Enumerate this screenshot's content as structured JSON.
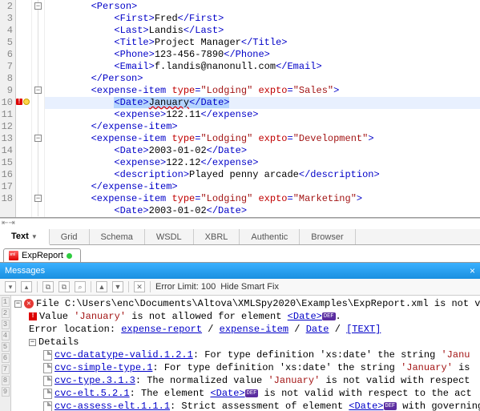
{
  "editor": {
    "lines": [
      {
        "num": 2,
        "indent": 2,
        "fold": "-",
        "parts": [
          {
            "t": "tag",
            "v": "<Person>"
          }
        ]
      },
      {
        "num": 3,
        "indent": 3,
        "parts": [
          {
            "t": "tag",
            "v": "<First>"
          },
          {
            "t": "txt",
            "v": "Fred"
          },
          {
            "t": "tag",
            "v": "</First>"
          }
        ]
      },
      {
        "num": 4,
        "indent": 3,
        "parts": [
          {
            "t": "tag",
            "v": "<Last>"
          },
          {
            "t": "txt",
            "v": "Landis"
          },
          {
            "t": "tag",
            "v": "</Last>"
          }
        ]
      },
      {
        "num": 5,
        "indent": 3,
        "parts": [
          {
            "t": "tag",
            "v": "<Title>"
          },
          {
            "t": "txt",
            "v": "Project Manager"
          },
          {
            "t": "tag",
            "v": "</Title>"
          }
        ]
      },
      {
        "num": 6,
        "indent": 3,
        "parts": [
          {
            "t": "tag",
            "v": "<Phone>"
          },
          {
            "t": "txt",
            "v": "123-456-7890"
          },
          {
            "t": "tag",
            "v": "</Phone>"
          }
        ]
      },
      {
        "num": 7,
        "indent": 3,
        "parts": [
          {
            "t": "tag",
            "v": "<Email>"
          },
          {
            "t": "txt",
            "v": "f.landis@nanonull.com"
          },
          {
            "t": "tag",
            "v": "</Email>"
          }
        ]
      },
      {
        "num": 8,
        "indent": 2,
        "parts": [
          {
            "t": "tag",
            "v": "</Person>"
          }
        ]
      },
      {
        "num": 9,
        "indent": 2,
        "fold": "-",
        "parts": [
          {
            "t": "tag",
            "v": "<expense-item "
          },
          {
            "t": "attr",
            "v": "type"
          },
          {
            "t": "tag",
            "v": "="
          },
          {
            "t": "val",
            "v": "\"Lodging\""
          },
          {
            "t": "tag",
            "v": " "
          },
          {
            "t": "attr",
            "v": "expto"
          },
          {
            "t": "tag",
            "v": "="
          },
          {
            "t": "val",
            "v": "\"Sales\""
          },
          {
            "t": "tag",
            "v": ">"
          }
        ]
      },
      {
        "num": 10,
        "indent": 3,
        "error": true,
        "highlight": true,
        "selection": true,
        "parts": [
          {
            "t": "tag",
            "v": "<Date>"
          },
          {
            "t": "txt",
            "v": "January",
            "squig": true
          },
          {
            "t": "tag",
            "v": "</Date>"
          }
        ]
      },
      {
        "num": 11,
        "indent": 3,
        "parts": [
          {
            "t": "tag",
            "v": "<expense>"
          },
          {
            "t": "txt",
            "v": "122.11"
          },
          {
            "t": "tag",
            "v": "</expense>"
          }
        ]
      },
      {
        "num": 12,
        "indent": 2,
        "parts": [
          {
            "t": "tag",
            "v": "</expense-item>"
          }
        ]
      },
      {
        "num": 13,
        "indent": 2,
        "fold": "-",
        "parts": [
          {
            "t": "tag",
            "v": "<expense-item "
          },
          {
            "t": "attr",
            "v": "type"
          },
          {
            "t": "tag",
            "v": "="
          },
          {
            "t": "val",
            "v": "\"Lodging\""
          },
          {
            "t": "tag",
            "v": " "
          },
          {
            "t": "attr",
            "v": "expto"
          },
          {
            "t": "tag",
            "v": "="
          },
          {
            "t": "val",
            "v": "\"Development\""
          },
          {
            "t": "tag",
            "v": ">"
          }
        ]
      },
      {
        "num": 14,
        "indent": 3,
        "parts": [
          {
            "t": "tag",
            "v": "<Date>"
          },
          {
            "t": "txt",
            "v": "2003-01-02"
          },
          {
            "t": "tag",
            "v": "</Date>"
          }
        ]
      },
      {
        "num": 15,
        "indent": 3,
        "parts": [
          {
            "t": "tag",
            "v": "<expense>"
          },
          {
            "t": "txt",
            "v": "122.12"
          },
          {
            "t": "tag",
            "v": "</expense>"
          }
        ]
      },
      {
        "num": 16,
        "indent": 3,
        "parts": [
          {
            "t": "tag",
            "v": "<description>"
          },
          {
            "t": "txt",
            "v": "Played penny arcade"
          },
          {
            "t": "tag",
            "v": "</description>"
          }
        ]
      },
      {
        "num": 17,
        "indent": 2,
        "parts": [
          {
            "t": "tag",
            "v": "</expense-item>"
          }
        ]
      },
      {
        "num": 18,
        "indent": 2,
        "fold": "-",
        "parts": [
          {
            "t": "tag",
            "v": "<expense-item "
          },
          {
            "t": "attr",
            "v": "type"
          },
          {
            "t": "tag",
            "v": "="
          },
          {
            "t": "val",
            "v": "\"Lodging\""
          },
          {
            "t": "tag",
            "v": " "
          },
          {
            "t": "attr",
            "v": "expto"
          },
          {
            "t": "tag",
            "v": "="
          },
          {
            "t": "val",
            "v": "\"Marketing\""
          },
          {
            "t": "tag",
            "v": ">"
          }
        ]
      },
      {
        "num": "",
        "indent": 3,
        "parts": [
          {
            "t": "tag",
            "v": "<Date>"
          },
          {
            "t": "txt",
            "v": "2003-01-02"
          },
          {
            "t": "tag",
            "v": "</Date>"
          }
        ]
      }
    ]
  },
  "view_tabs": [
    "Text",
    "Grid",
    "Schema",
    "WSDL",
    "XBRL",
    "Authentic",
    "Browser"
  ],
  "active_view_tab": 0,
  "file_tab": {
    "name": "ExpReport"
  },
  "messages": {
    "title": "Messages",
    "error_limit_label": "Error Limit: 100",
    "hide_smart_fix": "Hide Smart Fix",
    "file_line": "File C:\\Users\\enc\\Documents\\Altova\\XMLSpy2020\\Examples\\ExpReport.xml is not v",
    "value_line_pre": "Value ",
    "value_line_val": "'January'",
    "value_line_mid": " is not allowed for element ",
    "value_line_elem": "<Date>",
    "loc_label": "Error location:",
    "loc_parts": [
      "expense-report",
      "expense-item",
      "Date",
      "[TEXT]"
    ],
    "details_label": "Details",
    "details": [
      {
        "code": "cvc-datatype-valid.1.2.1",
        "txt": ": For type definition 'xs:date' the string ",
        "tail": "'Janu"
      },
      {
        "code": "cvc-simple-type.1",
        "txt": ": For type definition 'xs:date' the string ",
        "tail": "'January'",
        "tail2": " is "
      },
      {
        "code": "cvc-type.3.1.3",
        "txt": ": The normalized value ",
        "tail": "'January'",
        "tail2": " is not valid with respect"
      },
      {
        "code": "cvc-elt.5.2.1",
        "txt": ": The element ",
        "elem": "<Date>",
        "tail2": " is not valid with respect to the act"
      },
      {
        "code": "cvc-assess-elt.1.1.1",
        "txt": ": Strict assessment of element ",
        "elem": "<Date>",
        "tail2": " with governing"
      }
    ],
    "strip_tabs": [
      "1",
      "2",
      "3",
      "4",
      "5",
      "6",
      "7",
      "8",
      "9"
    ]
  }
}
